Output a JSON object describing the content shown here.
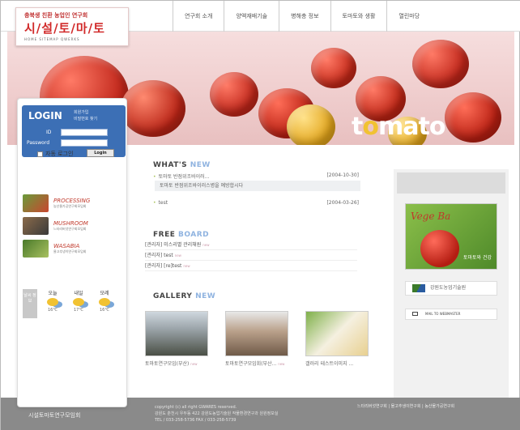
{
  "logo": {
    "tagline": "충북생 친환 농업인 연구회",
    "brand": "시/설/토/마/토",
    "mini_links": "HOME   SITEMAP   QWERKS"
  },
  "nav": [
    {
      "label": "연구회 소개"
    },
    {
      "label": "양액재배기술"
    },
    {
      "label": "병해충 정보"
    },
    {
      "label": "토마토와 생활"
    },
    {
      "label": "열린마당"
    }
  ],
  "hero": {
    "word_prefix": "t",
    "word_o": "o",
    "word_suffix": "mato"
  },
  "login": {
    "title": "LOGIN",
    "link_join": "회원가입",
    "link_find": "비밀번호 찾기",
    "id_label": "ID",
    "pw_label": "Password",
    "auto_login": "자동 로그인",
    "button": "Login"
  },
  "research": [
    {
      "name": "PROCESSING",
      "sub": "농산물가공연구회모임회"
    },
    {
      "name": "MUSHROOM",
      "sub": "느타리버섯연구회모임회"
    },
    {
      "name": "WASABIA",
      "sub": "물고추냉이연구회모임회"
    }
  ],
  "weather": {
    "label": "날씨\n정보",
    "days": [
      {
        "day": "오늘",
        "temp": "16℃"
      },
      {
        "day": "내일",
        "temp": "17℃"
      },
      {
        "day": "모레",
        "temp": "16℃"
      }
    ]
  },
  "whats_new": {
    "title": "WHAT'S",
    "accent": "NEW",
    "items": [
      {
        "text": "토마토 반점위조바이러...",
        "date": "[2004-10-30]"
      },
      {
        "text": "test",
        "date": "[2004-03-26]"
      }
    ],
    "preview": "토마토 반점위조바이러스병을 예방합시다"
  },
  "free_board": {
    "title": "FREE",
    "accent": "BOARD",
    "items": [
      {
        "text": "[관리자] 미스리별 관리채원",
        "badge": "new"
      },
      {
        "text": "[관리자] test",
        "badge": "new"
      },
      {
        "text": "[관리자] [re]test",
        "badge": "new"
      }
    ]
  },
  "gallery": {
    "title": "GALLERY",
    "accent": "NEW",
    "items": [
      {
        "caption": "토마토연구모임(부산)",
        "badge": "new"
      },
      {
        "caption": "토마토연구모임회(부산...",
        "badge": "new"
      },
      {
        "caption": "갤러리 테스트이미지 ...",
        "badge": ""
      }
    ]
  },
  "right": {
    "promo_script": "Vege Ba",
    "promo_caption": "토마토와 건강",
    "gangwon": "강원도농업기술원",
    "mail": "MAIL TO WEBMASTER"
  },
  "footer": {
    "org": "시설토마토연구모임회",
    "copyright": "copyright (c) all right GWARES reserved.",
    "address": "강원도 춘천시 우두동 422 강원도농업기술원 작물환경연구과 원원정보실",
    "phone": "TEL / 033-258-5736 FAX / 033-258-5739",
    "links": "느타리버섯연구회 | 물고추냉이연구회 | 농산물가공연구회"
  },
  "colors": {
    "brand_red": "#d12a2a",
    "login_blue": "#3c6fb5",
    "footer_gray": "#8a8a8a"
  }
}
